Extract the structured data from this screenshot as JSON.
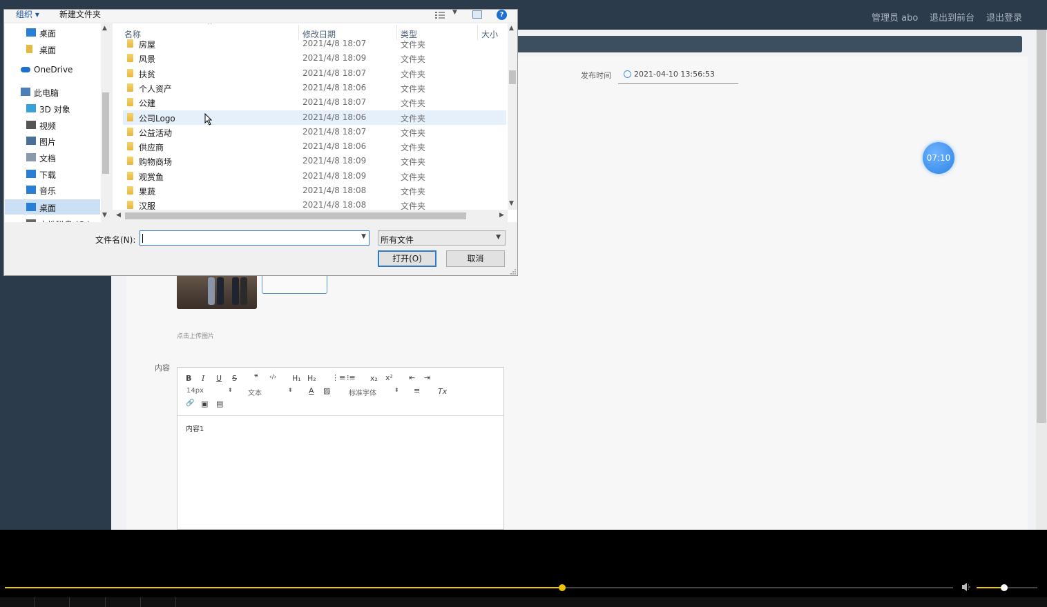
{
  "page": {
    "nav": {
      "admin": "管理员 abo",
      "frontend": "退出到前台",
      "logout": "退出登录"
    },
    "publish_label": "发布时间",
    "publish_time": "2021-04-10 13:56:53",
    "timer": "07:10",
    "upload_hint": "点击上传图片",
    "content_label": "内容",
    "editor": {
      "bold": "B",
      "italic": "I",
      "underline": "U",
      "strike": "S",
      "quote": "❞",
      "code": "‹/›",
      "h1": "H₁",
      "h2": "H₂",
      "ol": "⋮≡",
      "ul": "⁝≡",
      "sub": "x₂",
      "sup": "x²",
      "outdent": "⇤",
      "indent": "⇥",
      "font_size": "14px",
      "block_type": "文本",
      "font_family": "标准字体",
      "text_color": "A",
      "bg_color": "▨",
      "align": "≡",
      "clear": "Tx",
      "link": "🔗",
      "image": "▣",
      "video": "▤",
      "text": "内容1"
    }
  },
  "dialog": {
    "toolbar": {
      "organize": "组织 ▾",
      "new_folder": "新建文件夹",
      "help": "?"
    },
    "nav_items": [
      {
        "label": "桌面",
        "icon": "desktop-icon",
        "indent": 1
      },
      {
        "label": "桌面",
        "icon": "folder-icon",
        "indent": 1
      },
      {
        "label": "OneDrive",
        "icon": "cloud-icon",
        "indent": 0
      },
      {
        "label": "此电脑",
        "icon": "computer-icon",
        "indent": 0
      },
      {
        "label": "3D 对象",
        "icon": "cube-icon",
        "indent": 1
      },
      {
        "label": "视频",
        "icon": "video-icon",
        "indent": 1
      },
      {
        "label": "图片",
        "icon": "picture-icon",
        "indent": 1
      },
      {
        "label": "文档",
        "icon": "document-icon",
        "indent": 1
      },
      {
        "label": "下载",
        "icon": "download-icon",
        "indent": 1
      },
      {
        "label": "音乐",
        "icon": "music-icon",
        "indent": 1
      },
      {
        "label": "桌面",
        "icon": "desktop-icon",
        "indent": 1,
        "selected": true
      },
      {
        "label": "本地磁盘 (C:)",
        "icon": "drive-icon",
        "indent": 1
      }
    ],
    "columns": {
      "name": "名称",
      "modified": "修改日期",
      "type": "类型",
      "size": "大小"
    },
    "rows": [
      {
        "name": "房屋",
        "modified": "2021/4/8 18:07",
        "type": "文件夹"
      },
      {
        "name": "风景",
        "modified": "2021/4/8 18:09",
        "type": "文件夹"
      },
      {
        "name": "扶贫",
        "modified": "2021/4/8 18:07",
        "type": "文件夹"
      },
      {
        "name": "个人资产",
        "modified": "2021/4/8 18:06",
        "type": "文件夹"
      },
      {
        "name": "公建",
        "modified": "2021/4/8 18:07",
        "type": "文件夹"
      },
      {
        "name": "公司Logo",
        "modified": "2021/4/8 18:06",
        "type": "文件夹",
        "hover": true
      },
      {
        "name": "公益活动",
        "modified": "2021/4/8 18:07",
        "type": "文件夹"
      },
      {
        "name": "供应商",
        "modified": "2021/4/8 18:06",
        "type": "文件夹"
      },
      {
        "name": "购物商场",
        "modified": "2021/4/8 18:09",
        "type": "文件夹"
      },
      {
        "name": "观赏鱼",
        "modified": "2021/4/8 18:09",
        "type": "文件夹"
      },
      {
        "name": "果蔬",
        "modified": "2021/4/8 18:08",
        "type": "文件夹"
      },
      {
        "name": "汉服",
        "modified": "2021/4/8 18:08",
        "type": "文件夹"
      }
    ],
    "filename_label": "文件名(N):",
    "filename_value": "",
    "filetype": "所有文件",
    "open_button": "打开(O)",
    "cancel_button": "取消"
  },
  "player": {
    "progress": 0.588,
    "volume": 0.45,
    "accent": "#f0c400"
  }
}
